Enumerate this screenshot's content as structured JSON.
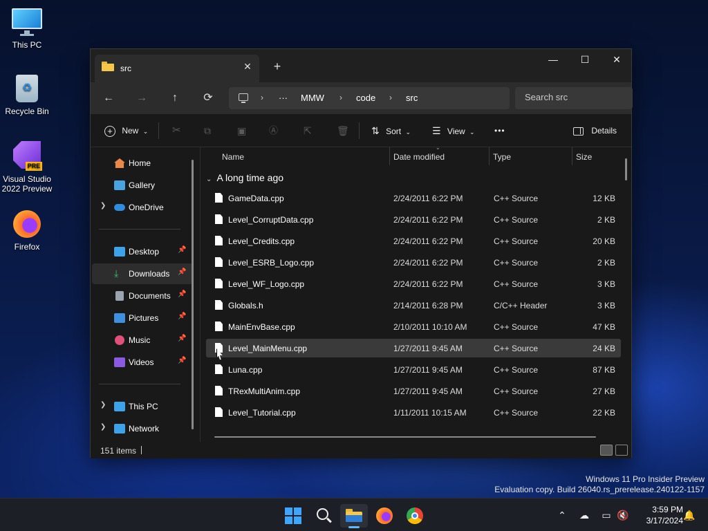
{
  "desktop": {
    "icons": [
      {
        "label": "This PC"
      },
      {
        "label": "Recycle Bin"
      },
      {
        "label": "Visual Studio 2022 Preview",
        "badge": "PRE"
      },
      {
        "label": "Firefox"
      }
    ]
  },
  "window": {
    "tab_title": "src",
    "tab_close": "✕",
    "tab_add": "+",
    "controls": {
      "minimize": "—",
      "maximize": "☐",
      "close": "✕"
    }
  },
  "navbar": {
    "back": "←",
    "forward": "→",
    "up": "↑",
    "refresh": "⟳",
    "breadcrumb": [
      "MMW",
      "code",
      "src"
    ],
    "more": "···",
    "search_placeholder": "Search src"
  },
  "toolbar": {
    "new_label": "New",
    "sort_label": "Sort",
    "view_label": "View",
    "more_label": "•••",
    "details_label": "Details"
  },
  "navpane": {
    "items": [
      {
        "label": "Home",
        "icon": "home-icon",
        "color": "#e8884a"
      },
      {
        "label": "Gallery",
        "icon": "gallery-icon",
        "color": "#4aa3df"
      },
      {
        "label": "OneDrive",
        "icon": "cloud-icon",
        "color": "#2e8de0"
      },
      {
        "label": "Desktop",
        "icon": "desktop-icon",
        "color": "#3da3e8"
      },
      {
        "label": "Downloads",
        "icon": "download-icon",
        "color": "#3bbf7a"
      },
      {
        "label": "Documents",
        "icon": "document-icon",
        "color": "#9aa4b1"
      },
      {
        "label": "Pictures",
        "icon": "pictures-icon",
        "color": "#3f8fe0"
      },
      {
        "label": "Music",
        "icon": "music-icon",
        "color": "#e0507a"
      },
      {
        "label": "Videos",
        "icon": "video-icon",
        "color": "#8a5ae0"
      },
      {
        "label": "This PC",
        "icon": "pc-icon",
        "color": "#3da3e8"
      },
      {
        "label": "Network",
        "icon": "network-icon",
        "color": "#3da3e8"
      }
    ]
  },
  "filelist": {
    "columns": {
      "name": "Name",
      "date": "Date modified",
      "type": "Type",
      "size": "Size"
    },
    "group_label": "A long time ago",
    "rows": [
      {
        "name": "GameData.cpp",
        "date": "2/24/2011 6:22 PM",
        "type": "C++ Source",
        "size": "12 KB"
      },
      {
        "name": "Level_CorruptData.cpp",
        "date": "2/24/2011 6:22 PM",
        "type": "C++ Source",
        "size": "2 KB"
      },
      {
        "name": "Level_Credits.cpp",
        "date": "2/24/2011 6:22 PM",
        "type": "C++ Source",
        "size": "20 KB"
      },
      {
        "name": "Level_ESRB_Logo.cpp",
        "date": "2/24/2011 6:22 PM",
        "type": "C++ Source",
        "size": "2 KB"
      },
      {
        "name": "Level_WF_Logo.cpp",
        "date": "2/24/2011 6:22 PM",
        "type": "C++ Source",
        "size": "3 KB"
      },
      {
        "name": "Globals.h",
        "date": "2/14/2011 6:28 PM",
        "type": "C/C++ Header",
        "size": "3 KB"
      },
      {
        "name": "MainEnvBase.cpp",
        "date": "2/10/2011 10:10 AM",
        "type": "C++ Source",
        "size": "47 KB"
      },
      {
        "name": "Level_MainMenu.cpp",
        "date": "1/27/2011 9:45 AM",
        "type": "C++ Source",
        "size": "24 KB"
      },
      {
        "name": "Luna.cpp",
        "date": "1/27/2011 9:45 AM",
        "type": "C++ Source",
        "size": "87 KB"
      },
      {
        "name": "TRexMultiAnim.cpp",
        "date": "1/27/2011 9:45 AM",
        "type": "C++ Source",
        "size": "27 KB"
      },
      {
        "name": "Level_Tutorial.cpp",
        "date": "1/11/2011 10:15 AM",
        "type": "C++ Source",
        "size": "22 KB"
      }
    ]
  },
  "status": {
    "items_count": "151 items"
  },
  "watermark": {
    "line1": "Windows 11 Pro Insider Preview",
    "line2": "Evaluation copy. Build 26040.rs_prerelease.240122-1157"
  },
  "taskbar": {
    "time": "3:59 PM",
    "date": "3/17/2024"
  }
}
